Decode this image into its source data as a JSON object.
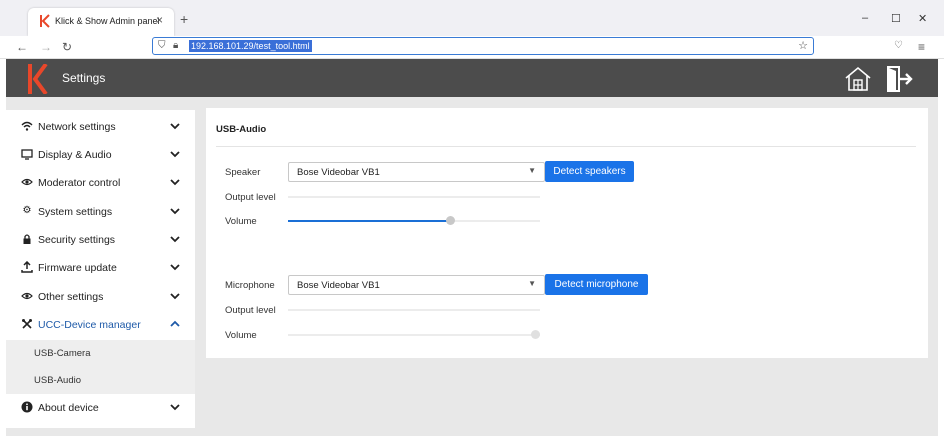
{
  "browser": {
    "tab_title": "Klick & Show Admin panel",
    "tab_close": "×",
    "new_tab": "+",
    "url": "192.168.101.29/test_tool.html",
    "win_min": "–",
    "win_max": "☐",
    "win_close": "✕"
  },
  "app": {
    "title": "Settings",
    "brand_color": "#e8472a"
  },
  "sidebar": {
    "items": [
      {
        "label": "Network settings",
        "icon": "wifi-icon"
      },
      {
        "label": "Display & Audio",
        "icon": "monitor-icon"
      },
      {
        "label": "Moderator control",
        "icon": "eye-icon"
      },
      {
        "label": "System settings",
        "icon": "gear-icon"
      },
      {
        "label": "Security settings",
        "icon": "lock-icon"
      },
      {
        "label": "Firmware update",
        "icon": "upload-icon"
      },
      {
        "label": "Other settings",
        "icon": "eye-icon"
      },
      {
        "label": "UCC-Device manager",
        "icon": "tools-icon",
        "expanded": true
      },
      {
        "label": "About device",
        "icon": "info-icon"
      }
    ],
    "subitems": [
      "USB-Camera",
      "USB-Audio"
    ]
  },
  "panel": {
    "title": "USB-Audio",
    "speaker": {
      "label": "Speaker",
      "selected": "Bose Videobar VB1",
      "detect_label": "Detect speakers",
      "output_level_label": "Output level",
      "volume_label": "Volume",
      "volume": 0.65
    },
    "microphone": {
      "label": "Microphone",
      "selected": "Bose Videobar VB1",
      "detect_label": "Detect microphone",
      "output_level_label": "Output level",
      "volume_label": "Volume",
      "volume": 1.0
    }
  }
}
